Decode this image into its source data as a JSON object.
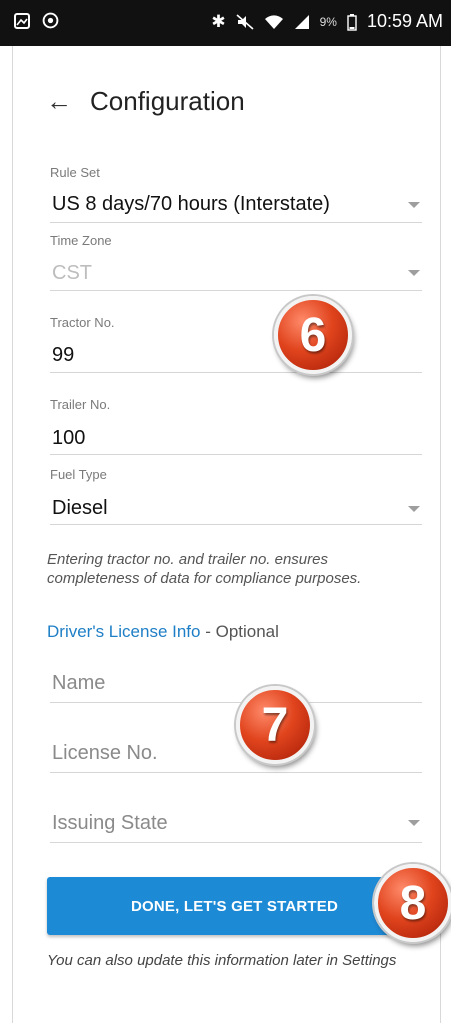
{
  "status_bar": {
    "left_icons": [
      "gallery-icon",
      "sync-icon"
    ],
    "right_icons": [
      "bluetooth-icon",
      "mute-icon",
      "wifi-icon",
      "signal-icon"
    ],
    "battery": "9%",
    "time": "10:59 AM"
  },
  "header": {
    "title": "Configuration"
  },
  "form": {
    "rule_set": {
      "label": "Rule Set",
      "value": "US 8 days/70 hours (Interstate)"
    },
    "time_zone": {
      "label": "Time Zone",
      "value": "CST",
      "disabled": true
    },
    "tractor_no": {
      "label": "Tractor No.",
      "value": "99"
    },
    "trailer_no": {
      "label": "Trailer No.",
      "value": "100"
    },
    "fuel_type": {
      "label": "Fuel Type",
      "value": "Diesel"
    },
    "note": "Entering tractor no. and trailer no. ensures completeness of data for compliance purposes."
  },
  "license": {
    "heading_link": "Driver's License Info",
    "heading_suffix": " - Optional",
    "name_placeholder": "Name",
    "license_no_placeholder": "License No.",
    "issuing_state_placeholder": "Issuing State"
  },
  "actions": {
    "done_label": "DONE, LET'S GET STARTED"
  },
  "footer": {
    "note": "You can also update this information later in Settings"
  },
  "badges": {
    "six": "6",
    "seven": "7",
    "eight": "8"
  },
  "colors": {
    "accent": "#1d8ad6",
    "link": "#1e7fc6",
    "badge": "#e0441d",
    "status_bar": "#111111"
  }
}
